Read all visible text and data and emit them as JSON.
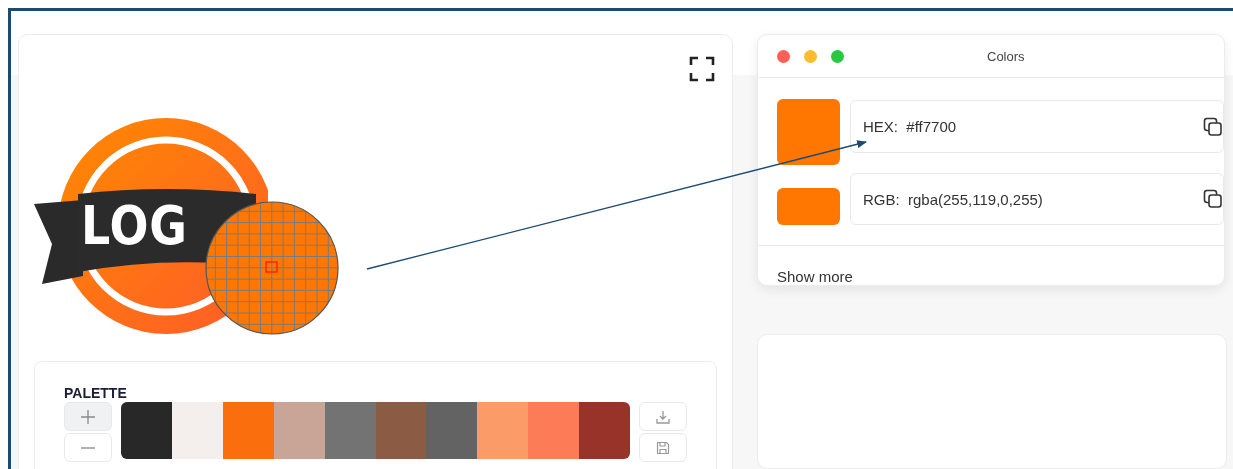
{
  "preview": {
    "logo_text": "LOG"
  },
  "palette": {
    "title": "PALETTE",
    "swatches": [
      {
        "color": "#282828"
      },
      {
        "color": "#f4efec"
      },
      {
        "color": "#fa6e0e"
      },
      {
        "color": "#c8a597"
      },
      {
        "color": "#737373"
      },
      {
        "color": "#8b5c43"
      },
      {
        "color": "#636363"
      },
      {
        "color": "#fb9c68"
      },
      {
        "color": "#fe7b57"
      },
      {
        "color": "#98332a"
      }
    ]
  },
  "colors_window": {
    "title": "Colors",
    "rows": [
      {
        "color": "#ff7700",
        "label": "HEX:",
        "value": "#ff7700"
      },
      {
        "color": "#ff7700",
        "label": "RGB:",
        "value": "rgba(255,119,0,255)"
      }
    ],
    "show_more": "Show more"
  }
}
